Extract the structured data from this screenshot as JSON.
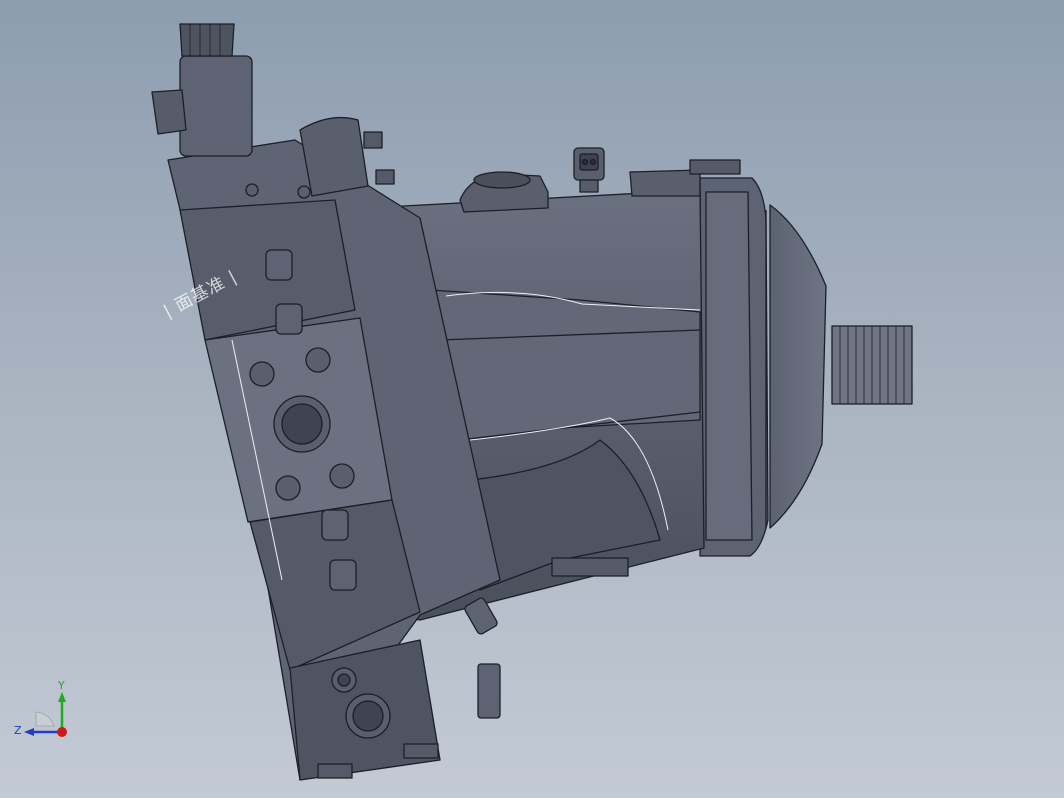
{
  "viewport": {
    "plane_label": "| 面基准 |"
  },
  "triad": {
    "y_label": "Y",
    "z_label": "Z",
    "colors": {
      "y_axis": "#22aa22",
      "z_axis": "#1b3fc8",
      "x_axis": "#d01818"
    }
  },
  "model": {
    "body_color": "#5b6070",
    "body_dark": "#454a58",
    "body_light": "#7a8092",
    "edge_color": "#1c1f28",
    "highlight_color": "#f2f4f8"
  }
}
